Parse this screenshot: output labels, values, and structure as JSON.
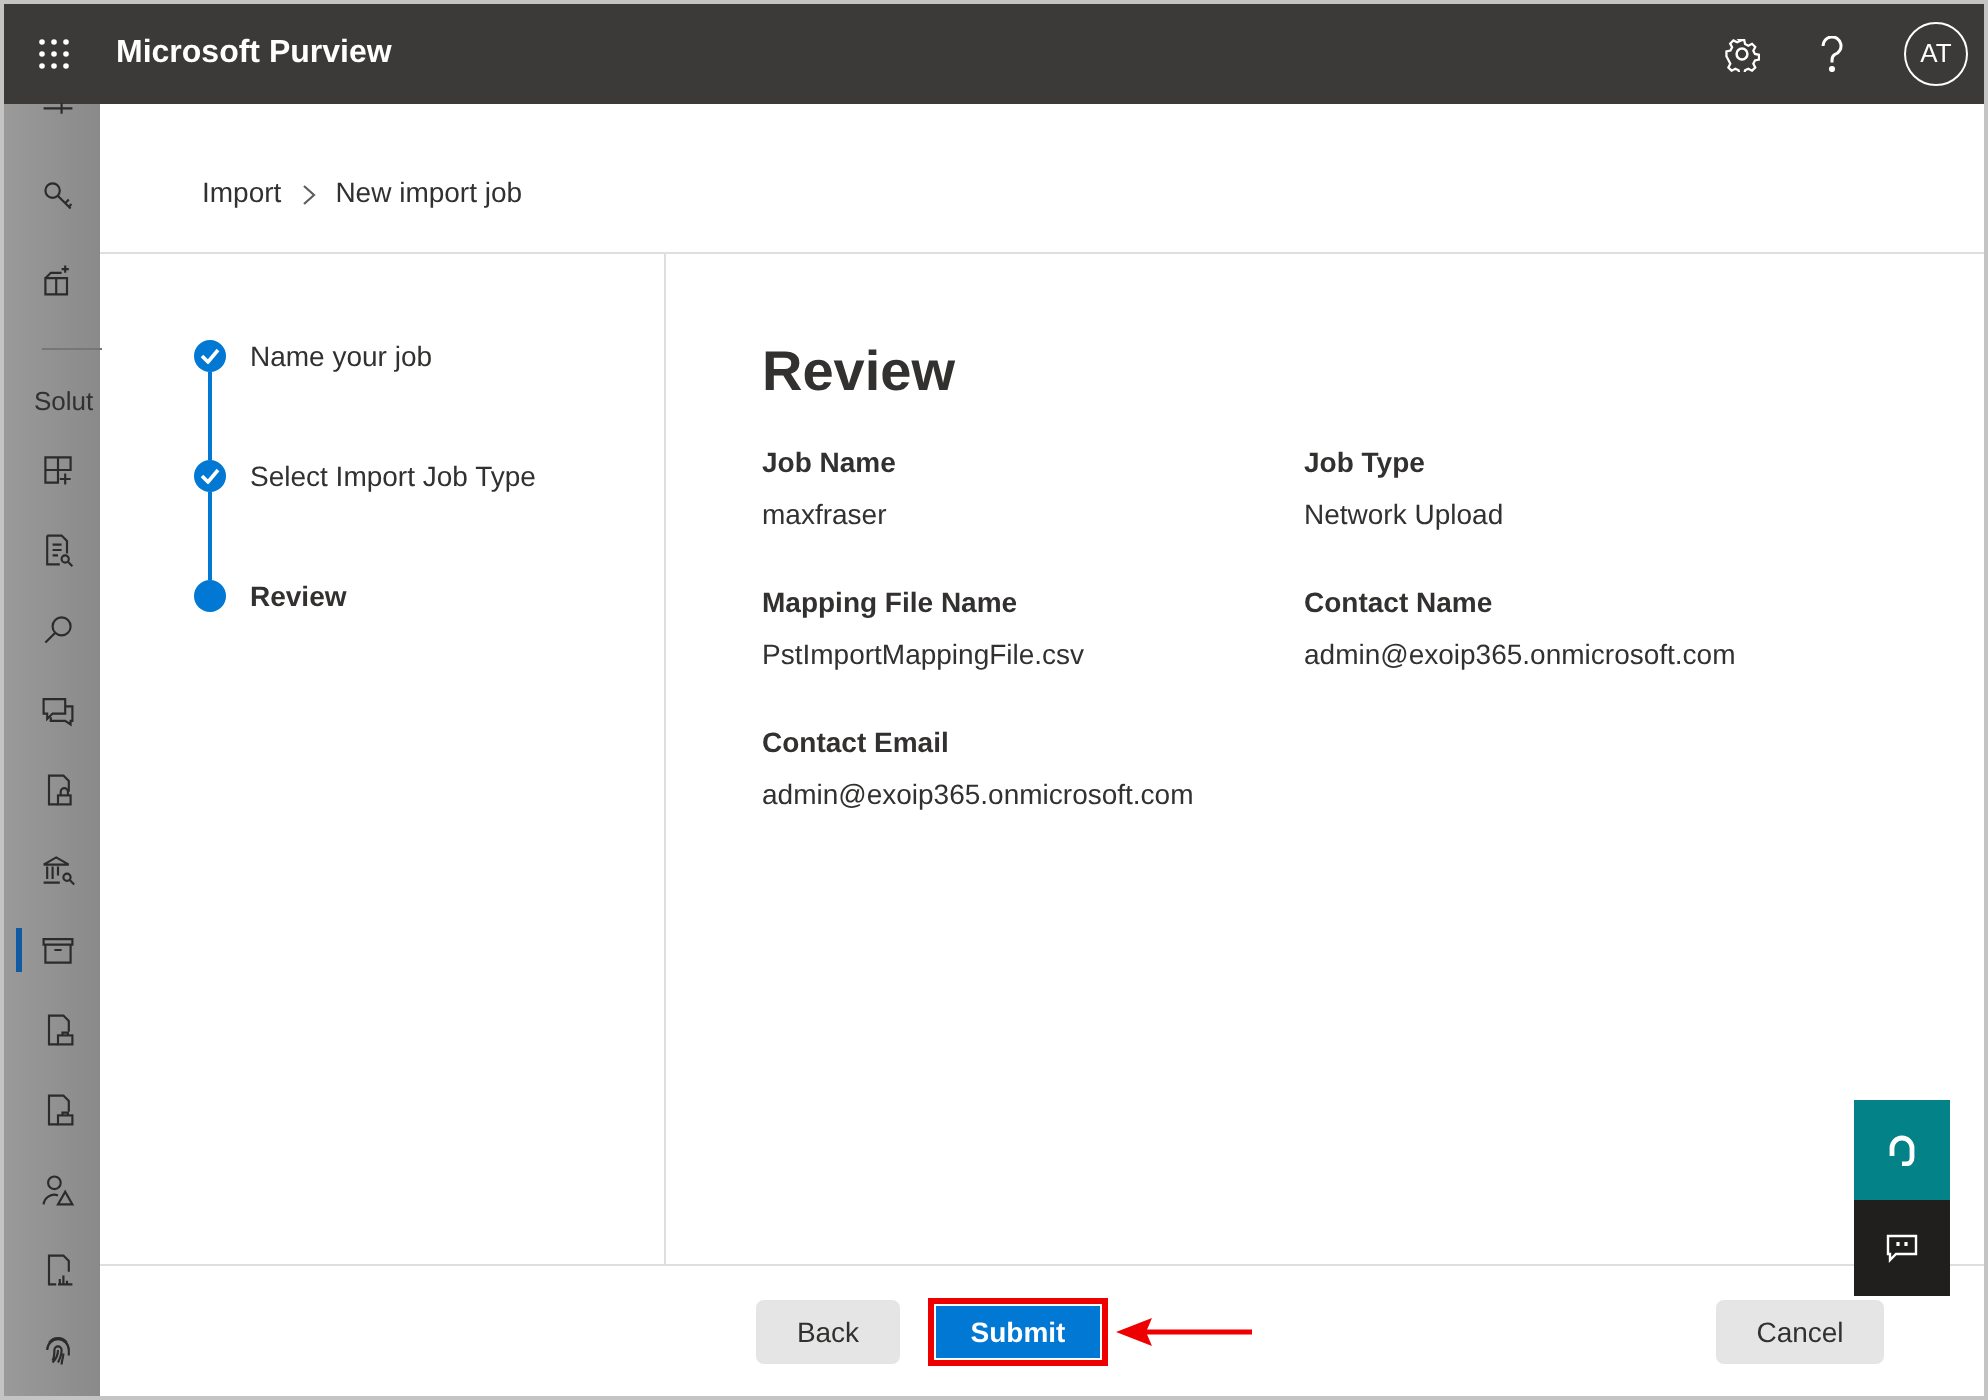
{
  "header": {
    "app_title": "Microsoft Purview",
    "avatar_initials": "AT"
  },
  "sidebar": {
    "top_items": [
      {
        "selected": false
      },
      {
        "selected": false
      },
      {
        "selected": false
      }
    ],
    "section_label": "Solut",
    "items": [
      {
        "selected": false
      },
      {
        "selected": false
      },
      {
        "selected": false
      },
      {
        "selected": false
      },
      {
        "selected": false
      },
      {
        "selected": false
      },
      {
        "selected": true
      },
      {
        "selected": false
      },
      {
        "selected": false
      },
      {
        "selected": false
      },
      {
        "selected": false
      },
      {
        "selected": false
      }
    ]
  },
  "breadcrumb": [
    "Import",
    "New import job"
  ],
  "steps": [
    {
      "label": "Name your job",
      "completed": true,
      "selected": false
    },
    {
      "label": "Select Import Job Type",
      "completed": true,
      "selected": false
    },
    {
      "label": "Review",
      "completed": false,
      "selected": true
    }
  ],
  "review": {
    "title": "Review",
    "fields": [
      {
        "label": "Job Name",
        "value": "maxfraser"
      },
      {
        "label": "Job Type",
        "value": "Network Upload"
      },
      {
        "label": "Mapping File Name",
        "value": "PstImportMappingFile.csv"
      },
      {
        "label": "Contact Name",
        "value": "admin@exoip365.onmicrosoft.com"
      },
      {
        "label": "Contact Email",
        "value": "admin@exoip365.onmicrosoft.com"
      }
    ]
  },
  "footer": {
    "back": "Back",
    "submit": "Submit",
    "cancel": "Cancel",
    "submit_highlighted": true
  }
}
